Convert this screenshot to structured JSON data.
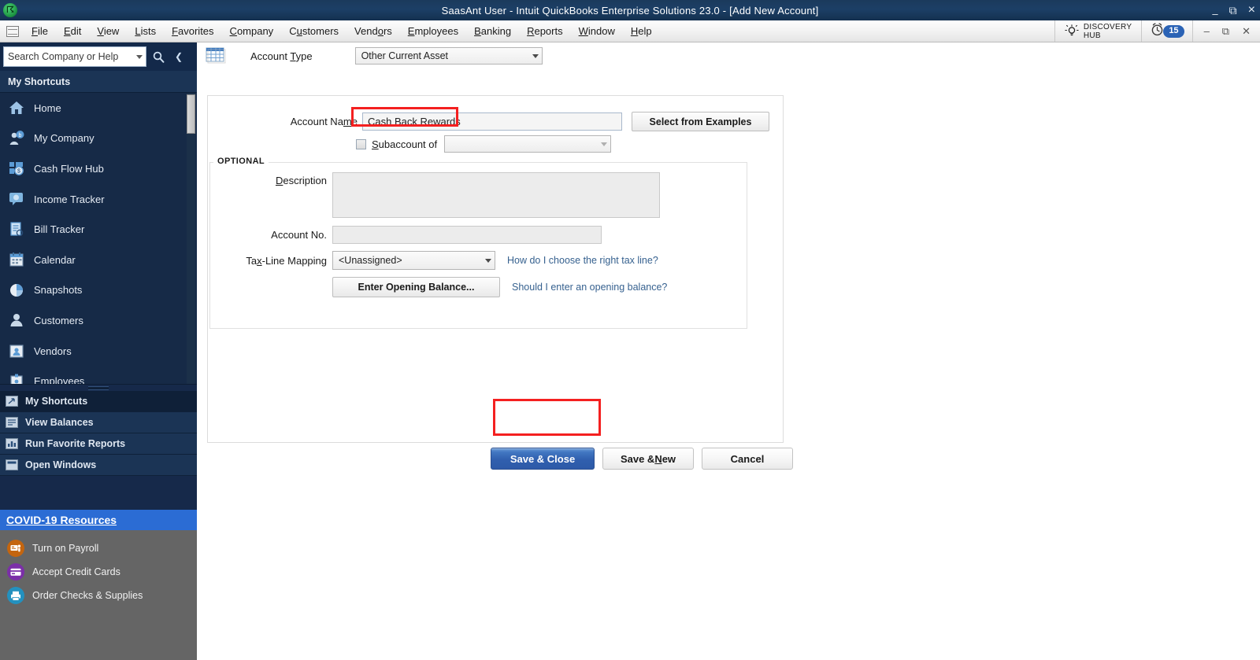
{
  "window": {
    "title": "SaasAnt User  - Intuit QuickBooks Enterprise Solutions 23.0 - [Add New Account]",
    "logo_icon": "quickbooks-logo-icon",
    "minimize_icon": "minimize-icon",
    "restore_icon": "restore-icon",
    "close_icon": "close-icon"
  },
  "menubar": {
    "system_icon": "system-menu-icon",
    "items": [
      {
        "label": "File",
        "mnemonic": "F"
      },
      {
        "label": "Edit",
        "mnemonic": "E"
      },
      {
        "label": "View",
        "mnemonic": "V"
      },
      {
        "label": "Lists",
        "mnemonic": "L"
      },
      {
        "label": "Favorites",
        "mnemonic": "F"
      },
      {
        "label": "Company",
        "mnemonic": "C"
      },
      {
        "label": "Customers",
        "mnemonic": "u"
      },
      {
        "label": "Vendors",
        "mnemonic": "o"
      },
      {
        "label": "Employees",
        "mnemonic": "E"
      },
      {
        "label": "Banking",
        "mnemonic": "B"
      },
      {
        "label": "Reports",
        "mnemonic": "R"
      },
      {
        "label": "Window",
        "mnemonic": "W"
      },
      {
        "label": "Help",
        "mnemonic": "H"
      }
    ],
    "discovery_hub": {
      "line1": "DISCOVERY",
      "line2": "HUB",
      "icon": "lightbulb-icon"
    },
    "alarm": {
      "icon": "alarm-clock-icon",
      "count": "15"
    },
    "window_controls": {
      "minimize": "–",
      "restore": "❐",
      "close": "×"
    }
  },
  "sidebar": {
    "search": {
      "placeholder": "Search Company or Help",
      "value": "",
      "dropdown_icon": "chevron-down-icon",
      "search_icon": "search-icon",
      "collapse_icon": "chevron-left-icon"
    },
    "shortcuts_header": "My Shortcuts",
    "items": [
      {
        "label": "Home",
        "icon": "home-icon"
      },
      {
        "label": "My Company",
        "icon": "my-company-icon"
      },
      {
        "label": "Cash Flow Hub",
        "icon": "cash-flow-hub-icon"
      },
      {
        "label": "Income Tracker",
        "icon": "income-tracker-icon"
      },
      {
        "label": "Bill Tracker",
        "icon": "bill-tracker-icon"
      },
      {
        "label": "Calendar",
        "icon": "calendar-icon"
      },
      {
        "label": "Snapshots",
        "icon": "snapshots-icon"
      },
      {
        "label": "Customers",
        "icon": "customers-icon"
      },
      {
        "label": "Vendors",
        "icon": "vendors-icon"
      },
      {
        "label": "Employees",
        "icon": "employees-icon"
      }
    ],
    "panels": [
      {
        "label": "My Shortcuts",
        "icon": "shortcuts-panel-icon",
        "active": true
      },
      {
        "label": "View Balances",
        "icon": "balances-panel-icon",
        "active": false
      },
      {
        "label": "Run Favorite Reports",
        "icon": "reports-panel-icon",
        "active": false
      },
      {
        "label": "Open Windows",
        "icon": "windows-panel-icon",
        "active": false
      }
    ],
    "covid_banner": "COVID-19 Resources",
    "promos": [
      {
        "label": "Turn on Payroll",
        "icon": "payroll-icon",
        "color": "#c4650f"
      },
      {
        "label": "Accept Credit Cards",
        "icon": "credit-card-icon",
        "color": "#7b2fa8"
      },
      {
        "label": "Order Checks & Supplies",
        "icon": "order-checks-icon",
        "color": "#2391bf"
      }
    ]
  },
  "form": {
    "window_icon": "account-grid-icon",
    "account_type": {
      "label": "Account Type",
      "mnemonic": "T",
      "value": "Other Current Asset",
      "dropdown_icon": "chevron-down-icon"
    },
    "account_name": {
      "label": "Account Name",
      "mnemonic": "m",
      "value": "Cash Back Rewards",
      "placeholder": ""
    },
    "select_examples_button": "Select from Examples",
    "subaccount": {
      "label": "Subaccount of",
      "mnemonic": "S",
      "checked": false,
      "value": "",
      "dropdown_icon": "chevron-down-icon"
    },
    "optional_legend": "OPTIONAL",
    "description": {
      "label": "Description",
      "mnemonic": "D",
      "value": ""
    },
    "account_no": {
      "label": "Account No.",
      "value": ""
    },
    "tax_line_mapping": {
      "label": "Tax-Line Mapping",
      "mnemonic": "x",
      "value": "<Unassigned>",
      "dropdown_icon": "chevron-down-icon"
    },
    "tax_help_link": "How do I choose the right tax line?",
    "opening_balance_button": "Enter Opening Balance...",
    "opening_balance_link": "Should I enter an opening balance?",
    "buttons": {
      "save_close": "Save & Close",
      "save_new": "Save & New",
      "cancel": "Cancel"
    }
  },
  "annotations": {
    "highlight_color": "#f42020",
    "highlighted_account_name": "Cash Back Rewards",
    "highlighted_button": "Save & Close"
  }
}
